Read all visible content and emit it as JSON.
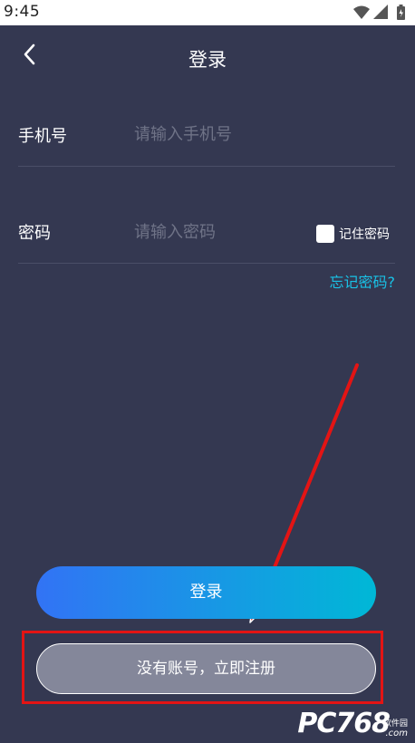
{
  "status_bar": {
    "time": "9:45",
    "icons": [
      "wifi-icon",
      "signal-icon",
      "battery-icon"
    ]
  },
  "nav": {
    "back_icon": "chevron-left-icon",
    "title": "登录"
  },
  "form": {
    "phone": {
      "label": "手机号",
      "placeholder": "请输入手机号",
      "value": ""
    },
    "password": {
      "label": "密码",
      "placeholder": "请输入密码",
      "value": ""
    },
    "remember": {
      "label": "记住密码",
      "checked": false
    },
    "forgot_link": "忘记密码?"
  },
  "buttons": {
    "login_label": "登录",
    "register_label": "没有账号，立即注册"
  },
  "watermark": {
    "text": "PC768",
    "sub": "软件园",
    "domain": ".com"
  },
  "colors": {
    "background": "#343851",
    "accent_link": "#19c2e6",
    "login_gradient_start": "#3273f5",
    "login_gradient_end": "#00b8d6",
    "highlight": "#e31414"
  }
}
